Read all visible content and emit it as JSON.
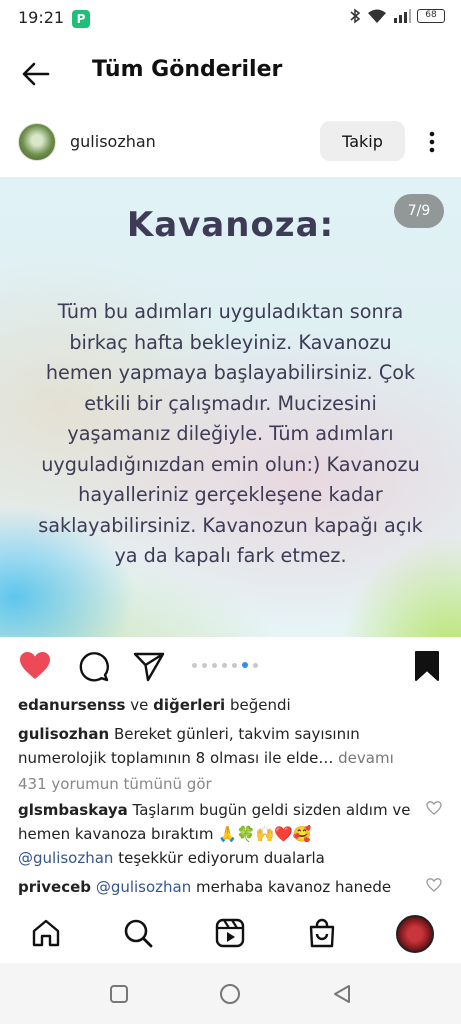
{
  "status_bar": {
    "time": "19:21",
    "battery": "68"
  },
  "header": {
    "title": "Tüm Gönderiler"
  },
  "post": {
    "username": "gulisozhan",
    "follow_label": "Takip",
    "page_indicator": "7/9",
    "title": "Kavanoza:",
    "body": "Tüm bu adımları uyguladıktan sonra birkaç hafta bekleyiniz. Kavanozu hemen yapmaya başlayabilirsiniz. Çok etkili bir çalışmadır. Mucizesini yaşamanız dileğiyle. Tüm adımları uyguladığınızdan emin olun:) Kavanozu hayalleriniz gerçekleşene kadar saklayabilirsiniz. Kavanozun kapağı açık ya da kapalı fark etmez.",
    "carousel": {
      "total_dots": 7,
      "active_index": 5
    }
  },
  "likes": {
    "first_user": "edanursenss",
    "connector": "ve",
    "others": "diğerleri",
    "suffix": "beğendi"
  },
  "caption": {
    "username": "gulisozhan",
    "text": "Bereket günleri, takvim sayısının numerolojik toplamının 8 olması ile elde…",
    "more": "devamı"
  },
  "view_comments": "431 yorumun tümünü gör",
  "comments": [
    {
      "username": "glsmbaskaya",
      "text": "Taşlarım bugün geldi sizden aldım ve hemen kavanoza bıraktım 🙏🍀🙌❤️🥰",
      "mention": "@gulisozhan",
      "text2": " teşekkür ediyorum dualarla"
    },
    {
      "username": "priveceb",
      "mention": "@gulisozhan",
      "text": " merhaba kavanoz hanede"
    }
  ],
  "icons": {
    "back": "arrow-left-icon",
    "more": "more-vertical-icon",
    "like": "heart-icon",
    "comment": "comment-icon",
    "share": "send-icon",
    "save": "bookmark-icon",
    "home": "home-icon",
    "search": "search-icon",
    "reels": "reels-icon",
    "shop": "shop-icon"
  },
  "colors": {
    "like_red": "#ed4956",
    "text_purple": "#3d3b55",
    "accent_blue": "#2f8df5",
    "mention_blue": "#34568b"
  }
}
